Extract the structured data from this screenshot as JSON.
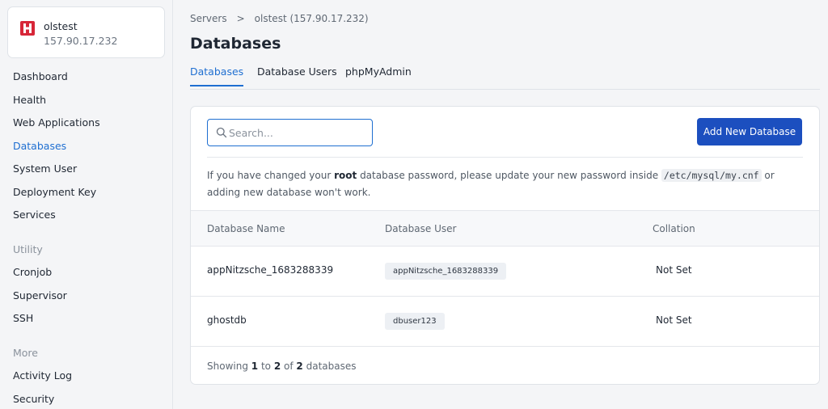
{
  "server": {
    "name": "olstest",
    "ip": "157.90.17.232",
    "logo_letter": "H",
    "brand_color": "#d72638"
  },
  "sidebar": {
    "items": [
      {
        "label": "Dashboard"
      },
      {
        "label": "Health"
      },
      {
        "label": "Web Applications"
      },
      {
        "label": "Databases",
        "active": true
      },
      {
        "label": "System User"
      },
      {
        "label": "Deployment Key"
      },
      {
        "label": "Services"
      }
    ],
    "utility_heading": "Utility",
    "utility_items": [
      {
        "label": "Cronjob"
      },
      {
        "label": "Supervisor"
      },
      {
        "label": "SSH"
      }
    ],
    "more_heading": "More",
    "more_items": [
      {
        "label": "Activity Log"
      },
      {
        "label": "Security"
      }
    ]
  },
  "breadcrumb": {
    "root": "Servers",
    "separator": ">",
    "current": "olstest (157.90.17.232)"
  },
  "page_title": "Databases",
  "tabs": [
    {
      "label": "Databases",
      "active": true
    },
    {
      "label": "Database Users"
    },
    {
      "label": "phpMyAdmin"
    }
  ],
  "search": {
    "placeholder": "Search...",
    "value": ""
  },
  "add_button_label": "Add New Database",
  "notice": {
    "prefix": "If you have changed your ",
    "bold": "root",
    "middle": " database password, please update your new password inside ",
    "code": "/etc/mysql/my.cnf",
    "suffix": " or adding new database won't work."
  },
  "table": {
    "headers": [
      "Database Name",
      "Database User",
      "Collation"
    ],
    "rows": [
      {
        "name": "appNitzsche_1683288339",
        "user": "appNitzsche_1683288339",
        "collation": "Not Set"
      },
      {
        "name": "ghostdb",
        "user": "dbuser123",
        "collation": "Not Set"
      }
    ]
  },
  "pagination": {
    "showing": "Showing",
    "from": "1",
    "to_word": "to",
    "to": "2",
    "of_word": "of",
    "total": "2",
    "suffix": "databases"
  },
  "colors": {
    "accent": "#1f6fd1",
    "primary_button": "#1c4fbf"
  }
}
